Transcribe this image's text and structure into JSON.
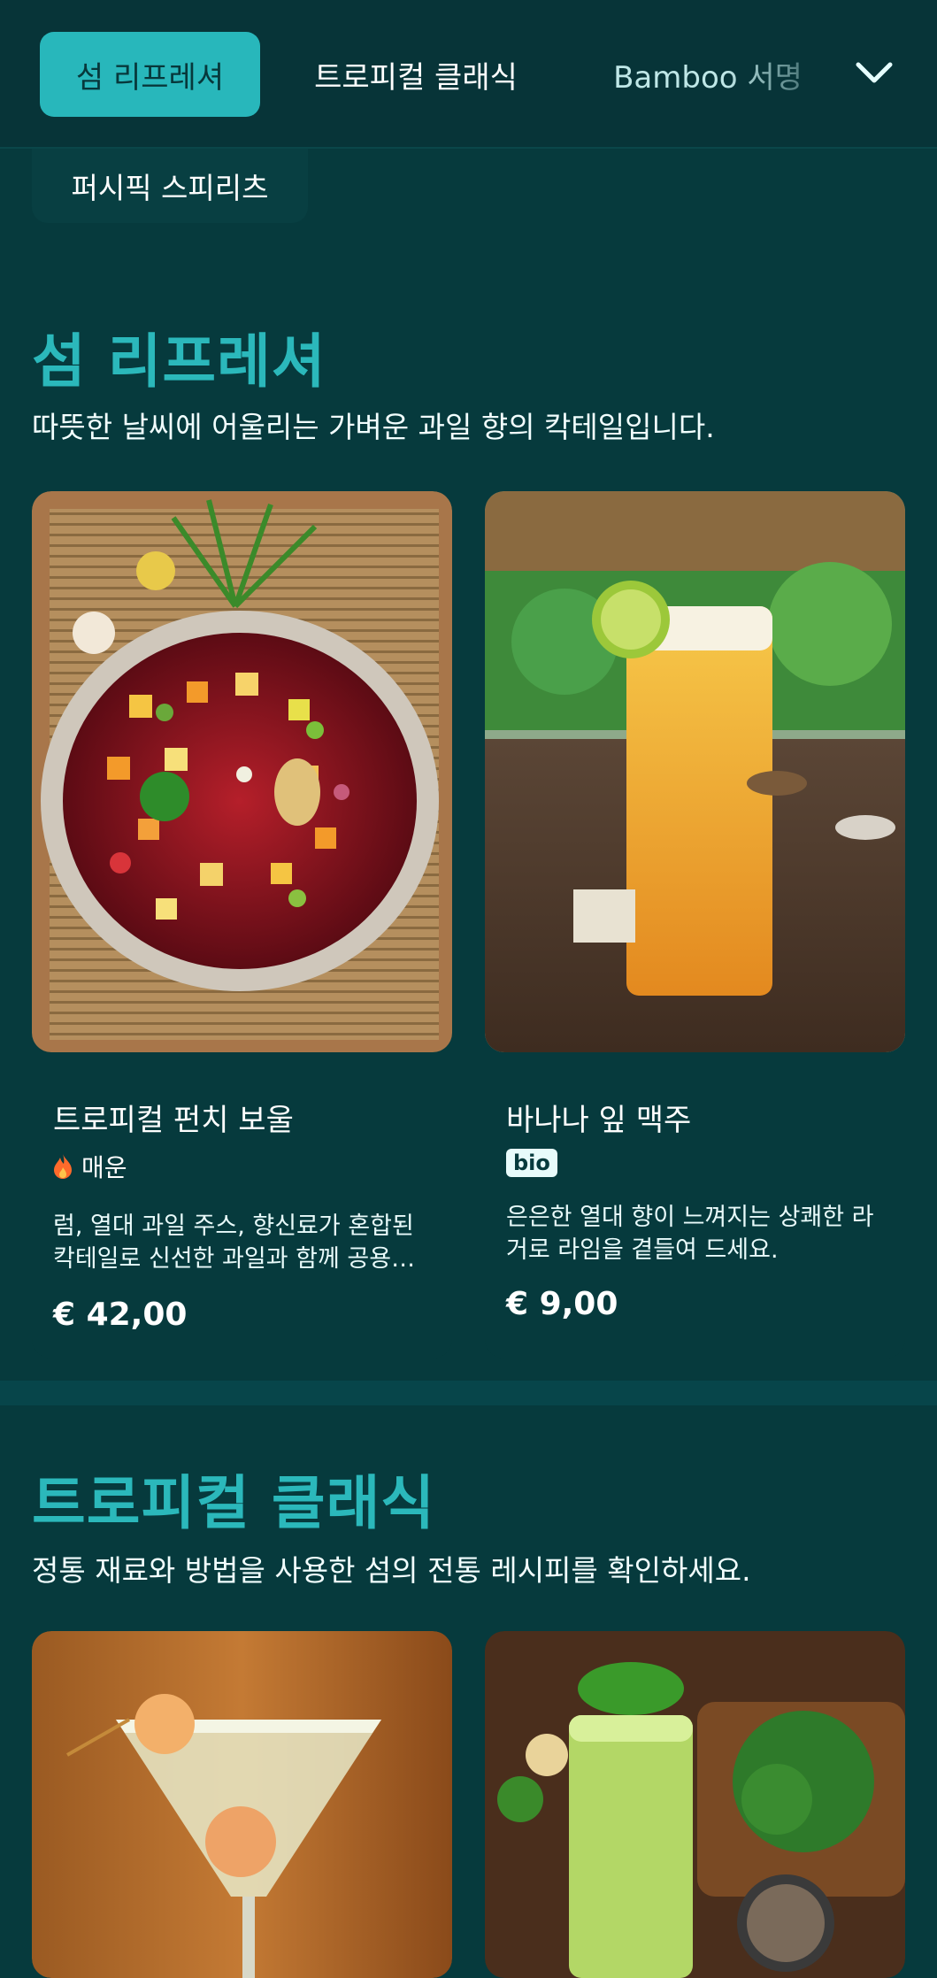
{
  "nav": {
    "tabs": [
      {
        "label": "섬 리프레셔",
        "active": true
      },
      {
        "label": "트로피컬 클래식",
        "active": false
      },
      {
        "label": "Bamboo 서명",
        "active": false
      }
    ],
    "overflow_chip": "퍼시픽 스피리츠",
    "expand_icon": "chevron-down-icon"
  },
  "sections": [
    {
      "title": "섬 리프레셔",
      "subtitle": "따뜻한 날씨에 어울리는 가벼운 과일 향의 칵테일입니다.",
      "items": [
        {
          "name": "트로피컬 펀치 보울",
          "tag": "매운",
          "tag_icon": "flame-icon",
          "description": "럼, 열대 과일 주스, 향신료가 혼합된 칵테일로 신선한 과일과 함께 공용으로 제공됩니다.",
          "price": "€ 42,00"
        },
        {
          "name": "바나나 잎 맥주",
          "tag": "bio",
          "description": "은은한 열대 향이 느껴지는 상쾌한 라거로 라임을 곁들여 드세요.",
          "price": "€ 9,00"
        }
      ]
    },
    {
      "title": "트로피컬 클래식",
      "subtitle": "정통 재료와 방법을 사용한 섬의 전통 레시피를 확인하세요."
    }
  ],
  "colors": {
    "background": "#063a3d",
    "accent": "#28b7bb",
    "tag_flame": "#ff6a2b"
  }
}
